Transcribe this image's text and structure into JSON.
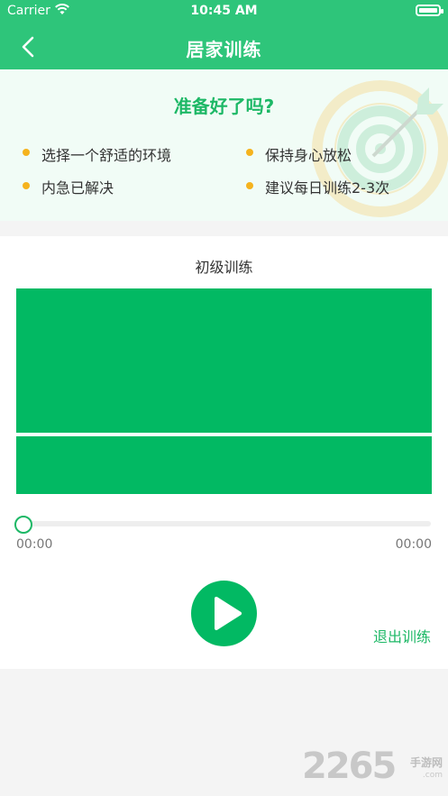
{
  "status_bar": {
    "carrier": "Carrier",
    "time": "10:45 AM"
  },
  "nav": {
    "title": "居家训练",
    "back_icon": "chevron-left-icon"
  },
  "ready": {
    "heading": "准备好了吗?",
    "tips": [
      "选择一个舒适的环境",
      "保持身心放松",
      "内急已解决",
      "建议每日训练2-3次"
    ]
  },
  "training": {
    "level": "初级训练",
    "progress": 0,
    "current_time": "00:00",
    "total_time": "00:00",
    "play_icon": "play-icon",
    "exit_label": "退出训练"
  },
  "watermark": {
    "number": "2265",
    "site": "手游网",
    "domain": ".com"
  },
  "colors": {
    "primary": "#2ec57a",
    "video": "#02b963",
    "accent_text": "#1db866",
    "bullet": "#f5b31e",
    "background": "#f4f4f4"
  }
}
